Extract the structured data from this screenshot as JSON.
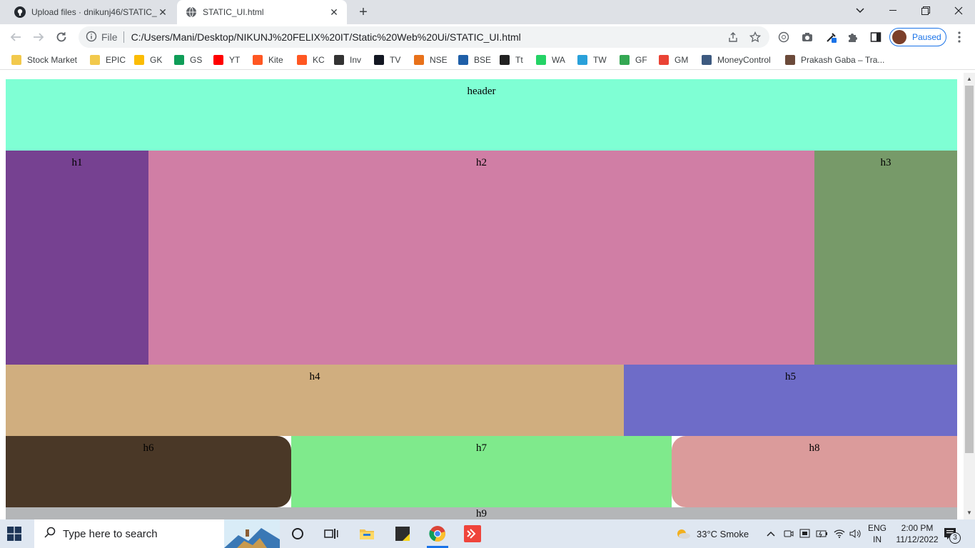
{
  "browser": {
    "tabs": [
      {
        "title": "Upload files · dnikunj46/STATIC_U",
        "icon": "github-icon",
        "active": false
      },
      {
        "title": "STATIC_UI.html",
        "icon": "globe-icon",
        "active": true
      }
    ],
    "new_tab_label": "+",
    "address": {
      "scheme_label": "File",
      "url": "C:/Users/Mani/Desktop/NIKUNJ%20FELIX%20IT/Static%20Web%20Ui/STATIC_UI.html"
    },
    "profile_label": "Paused",
    "bookmarks": [
      {
        "label": "Stock Market",
        "icon": "folder-icon",
        "color": "#f2c94c"
      },
      {
        "label": "EPIC",
        "icon": "folder-icon",
        "color": "#f2c94c"
      },
      {
        "label": "GK",
        "icon": "keep-icon",
        "color": "#fbbc04"
      },
      {
        "label": "GS",
        "icon": "sheets-icon",
        "color": "#0f9d58"
      },
      {
        "label": "YT",
        "icon": "youtube-icon",
        "color": "#ff0000"
      },
      {
        "label": "Kite",
        "icon": "kite-icon",
        "color": "#ff5722"
      },
      {
        "label": "KC",
        "icon": "kite-icon",
        "color": "#ff5722"
      },
      {
        "label": "Inv",
        "icon": "investing-icon",
        "color": "#333333"
      },
      {
        "label": "TV",
        "icon": "tradingview-icon",
        "color": "#131722"
      },
      {
        "label": "NSE",
        "icon": "nse-icon",
        "color": "#e8711a"
      },
      {
        "label": "BSE",
        "icon": "bse-icon",
        "color": "#1f5fa8"
      },
      {
        "label": "Tt",
        "icon": "tijori-icon",
        "color": "#222222"
      },
      {
        "label": "WA",
        "icon": "whatsapp-icon",
        "color": "#25d366"
      },
      {
        "label": "TW",
        "icon": "telegram-icon",
        "color": "#2aa1da"
      },
      {
        "label": "GF",
        "icon": "google-finance-icon",
        "color": "#34a853"
      },
      {
        "label": "GM",
        "icon": "gmail-icon",
        "color": "#ea4335"
      },
      {
        "label": "MoneyControl",
        "icon": "moneycontrol-icon",
        "color": "#3d5a80"
      },
      {
        "label": "Prakash Gaba – Tra...",
        "icon": "person-icon",
        "color": "#6b4a3a"
      }
    ]
  },
  "page": {
    "sections": [
      {
        "id": "header",
        "label": "header",
        "color": "#7fffd4"
      },
      {
        "id": "h1",
        "label": "h1",
        "color": "#764191"
      },
      {
        "id": "h2",
        "label": "h2",
        "color": "#d07ea5"
      },
      {
        "id": "h3",
        "label": "h3",
        "color": "#779a69"
      },
      {
        "id": "h4",
        "label": "h4",
        "color": "#d0ae7f"
      },
      {
        "id": "h5",
        "label": "h5",
        "color": "#6e6cc8"
      },
      {
        "id": "h6",
        "label": "h6",
        "color": "#4a3827"
      },
      {
        "id": "h7",
        "label": "h7",
        "color": "#7fea8c"
      },
      {
        "id": "h8",
        "label": "h8",
        "color": "#db9b9b"
      },
      {
        "id": "h9",
        "label": "h9",
        "color": "#b4b6b8"
      }
    ]
  },
  "taskbar": {
    "search_placeholder": "Type here to search",
    "weather": "33°C  Smoke",
    "language_line1": "ENG",
    "language_line2": "IN",
    "time": "2:00 PM",
    "date": "11/12/2022",
    "notification_count": "3"
  }
}
